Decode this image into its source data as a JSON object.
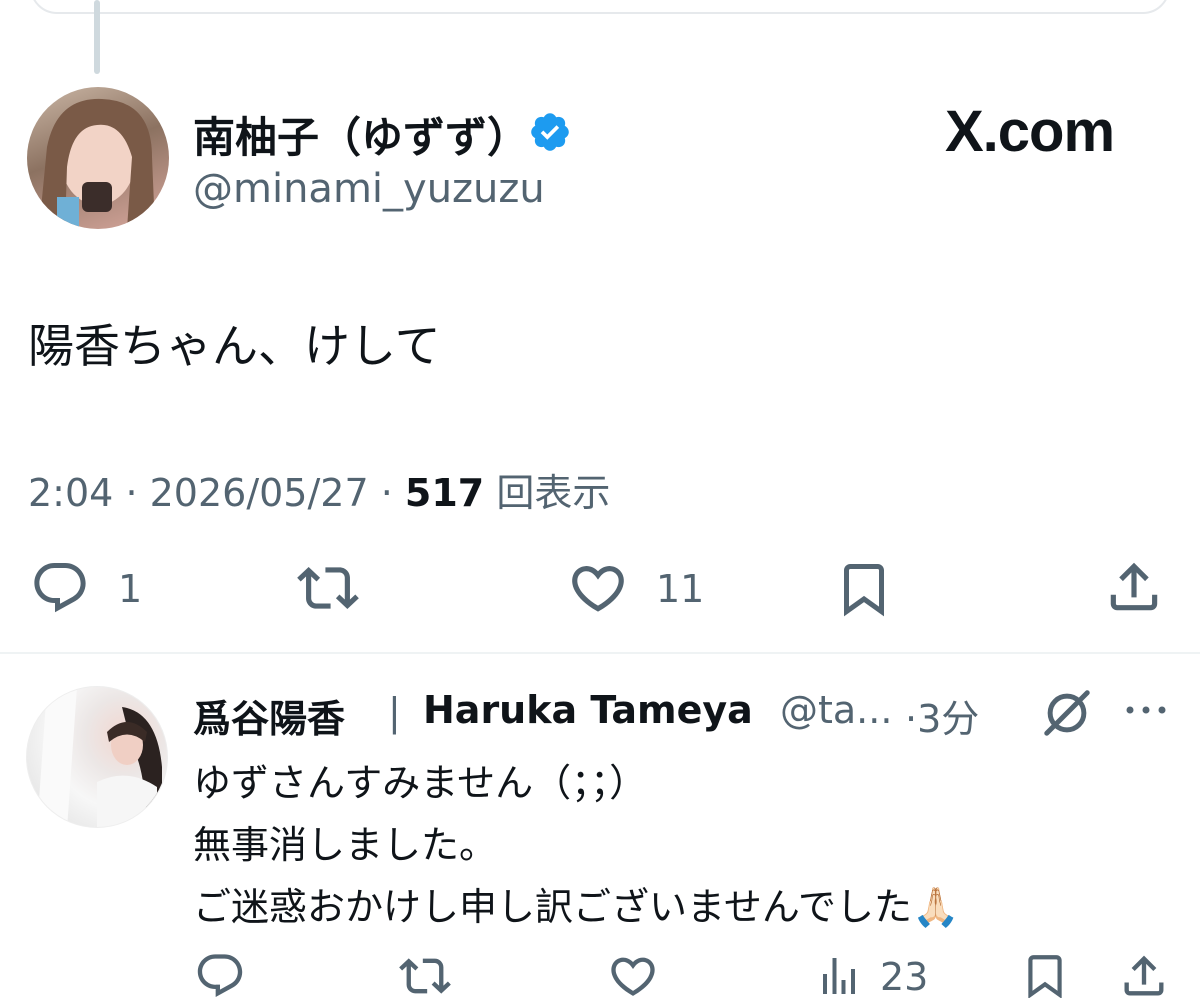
{
  "header": {
    "site_label": "X.com"
  },
  "tweet": {
    "author_name": "南柚子（ゆずず）",
    "author_handle": "@minami_yuzuzu",
    "verified": true,
    "text": "陽香ちゃん、けして",
    "time": "2:04",
    "date": "2026/05/27",
    "views_count": "517",
    "views_label": "回表示",
    "reply_count": "1",
    "like_count": "11"
  },
  "reply": {
    "author_name": "爲谷陽香",
    "separator": "|",
    "author_name_en": "Haruka Tameya",
    "author_handle": "@ta...",
    "time": "3分",
    "lines": [
      "ゆずさんすみません（；；）",
      "無事消しました。",
      "ご迷惑おかけし申し訳ございませんでした🙏🏻"
    ],
    "views_count": "23"
  },
  "colors": {
    "text": "#0f1419",
    "secondary": "#536471",
    "verified_blue": "#1d9bf0",
    "divider": "#eff3f4"
  }
}
